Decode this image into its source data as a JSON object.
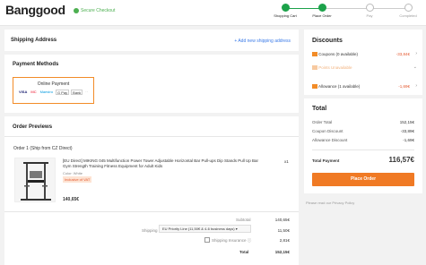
{
  "header": {
    "logo": "Banggood",
    "secure_label": "Secure Checkout",
    "steps": [
      {
        "label": "Shopping Cart",
        "state": "done"
      },
      {
        "label": "Place Order",
        "state": "current"
      },
      {
        "label": "Pay",
        "state": "todo"
      },
      {
        "label": "Completed",
        "state": "todo"
      }
    ]
  },
  "shipping": {
    "title": "Shipping Address",
    "add_link": "+ Add new shipping address"
  },
  "payment": {
    "title": "Payment Methods",
    "online_label": "Online Payment",
    "icons": [
      "VISA",
      "MC",
      "Maestro",
      "G Pay",
      "Bank",
      "··"
    ]
  },
  "order": {
    "title": "Order Previews",
    "subtitle": "Order 1 (Ship from CZ Direct)",
    "product": {
      "name": "[EU Direct] MIKING 045 Multifunction Power Tower Adjustable Horizontal Bar Pull-ups Dip Stands Pull Up Bar Gym Strength Training Fitness Equipment for Adult Kids",
      "color": "Color: White",
      "vat_badge": "Inclusive of VAT",
      "qty": "x1",
      "price": "140,65€"
    },
    "subtotal_label": "Subtotal",
    "subtotal_value": "140,65€",
    "shipping_label": "Shipping",
    "shipping_option": "EU Priority Line (11,50€ & 4-6 business days) ▾",
    "shipping_value": "11,50€",
    "insurance_label": "Shipping Insurance ⓘ",
    "insurance_value": "2,81€",
    "total_label": "Total",
    "total_value": "152,15€"
  },
  "discounts": {
    "title": "Discounts",
    "coupons_label": "Coupons (0 available)",
    "coupons_value": "-33,84€",
    "points_label": "Points Unavailable",
    "allowance_label": "Allowance (1 available)",
    "allowance_value": "-1,69€"
  },
  "total": {
    "title": "Total",
    "rows": [
      {
        "label": "Order Total",
        "value": "152,15€"
      },
      {
        "label": "Coupon Discount",
        "value": "-33,89€"
      },
      {
        "label": "Allowance Discount",
        "value": "-1,69€"
      }
    ],
    "payment_label": "Total Payment",
    "payment_value": "116,57€",
    "place_order": "Place Order",
    "policy_note": "Please read our Privacy Policy"
  },
  "colors": {
    "accent": "#f07a24",
    "step_done": "#1ca24a",
    "link": "#3b7be8",
    "discount": "#e4572e"
  }
}
